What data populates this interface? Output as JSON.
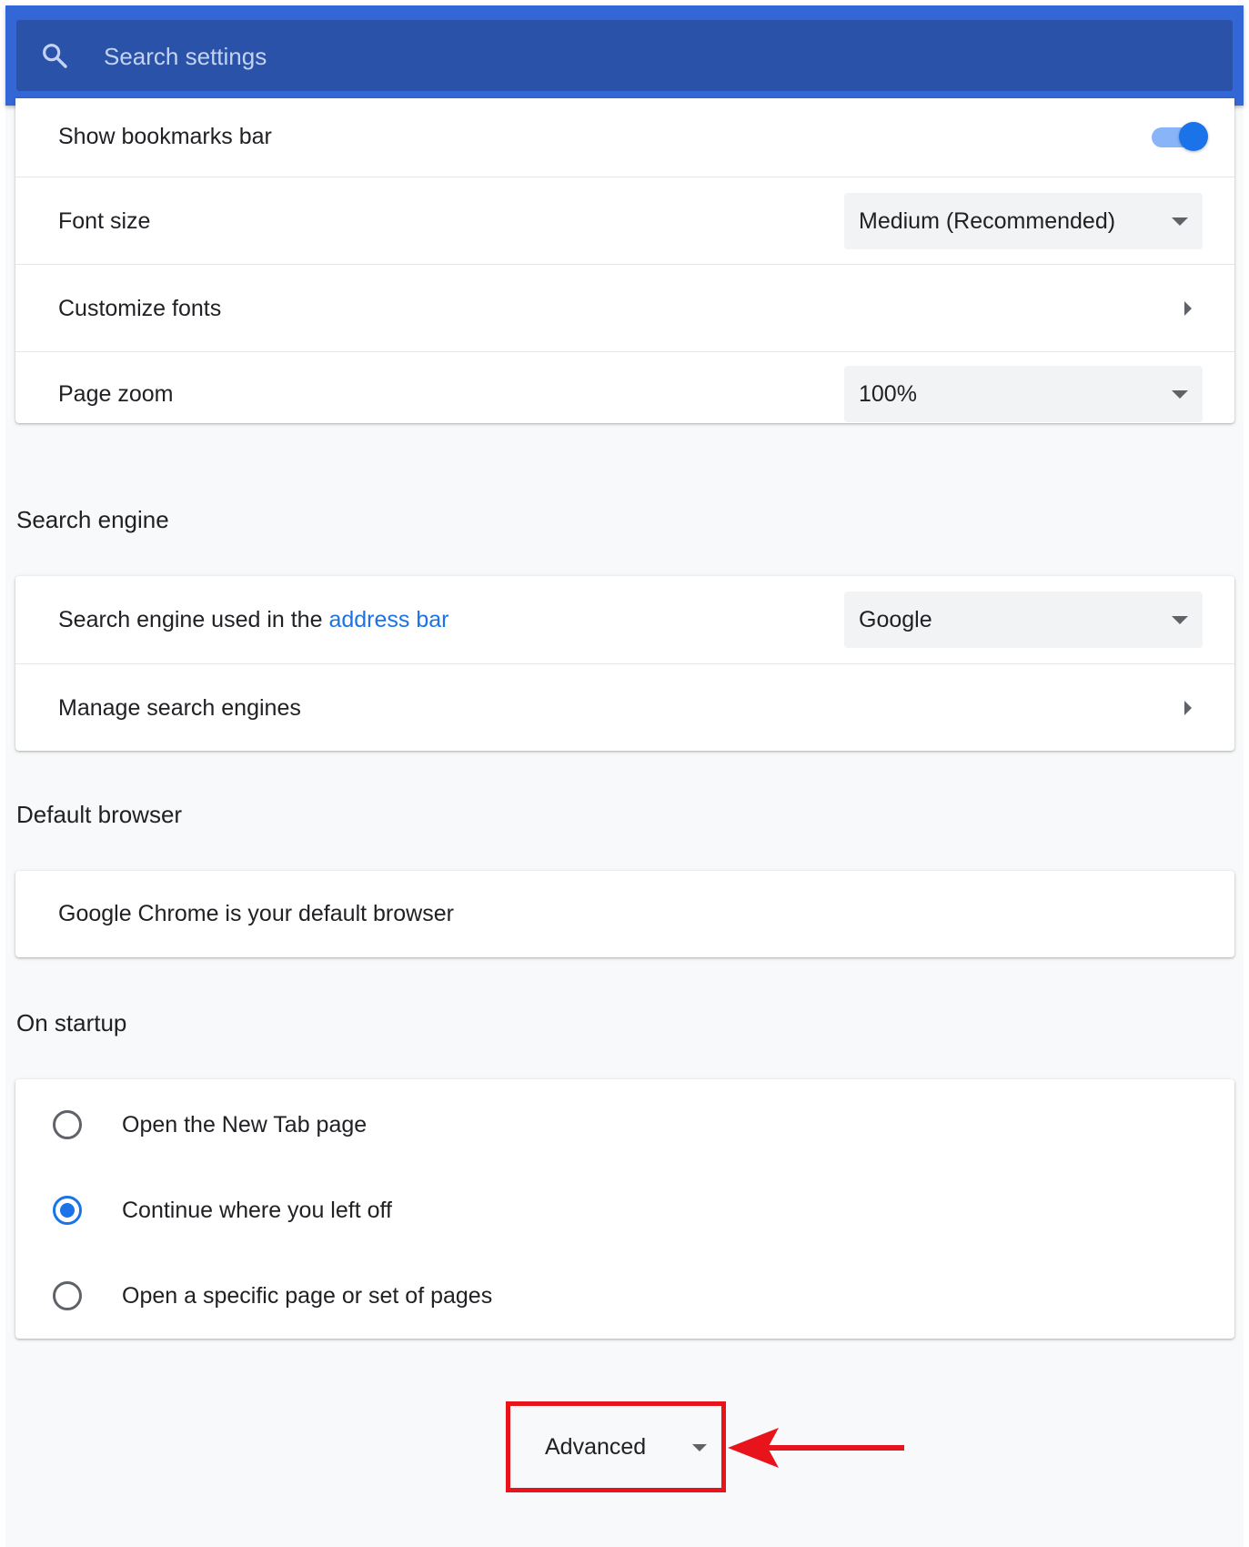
{
  "search": {
    "placeholder": "Search settings"
  },
  "appearance": {
    "show_bookmarks_bar_label": "Show bookmarks bar",
    "show_bookmarks_bar_on": true,
    "font_size_label": "Font size",
    "font_size_value": "Medium (Recommended)",
    "customize_fonts_label": "Customize fonts",
    "page_zoom_label": "Page zoom",
    "page_zoom_value": "100%"
  },
  "search_engine": {
    "title": "Search engine",
    "used_label_prefix": "Search engine used in the ",
    "used_label_link": "address bar",
    "engine_value": "Google",
    "manage_label": "Manage search engines"
  },
  "default_browser": {
    "title": "Default browser",
    "status": "Google Chrome is your default browser"
  },
  "on_startup": {
    "title": "On startup",
    "options": [
      {
        "label": "Open the New Tab page",
        "checked": false
      },
      {
        "label": "Continue where you left off",
        "checked": true
      },
      {
        "label": "Open a specific page or set of pages",
        "checked": false
      }
    ]
  },
  "advanced": {
    "label": "Advanced"
  },
  "colors": {
    "header": "#3367d6",
    "search_box": "#2a52a8",
    "accent": "#1a73e8",
    "annotation": "#e8141c"
  }
}
